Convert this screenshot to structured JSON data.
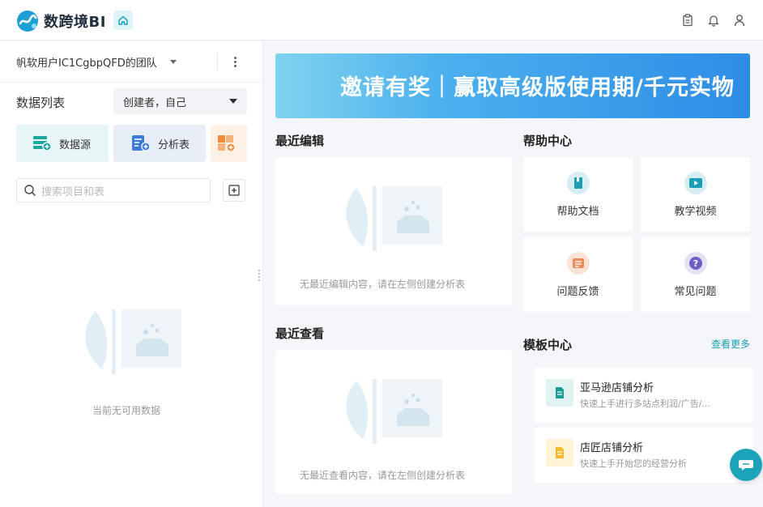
{
  "app": {
    "brand": "数跨境BI"
  },
  "team": {
    "name": "帆软用户IC1CgbpQFD的团队"
  },
  "sidebar": {
    "title": "数据列表",
    "creator_filter": "创建者，自己",
    "buttons": {
      "datasource": "数据源",
      "analysis": "分析表"
    },
    "search_placeholder": "搜索项目和表",
    "empty_text": "当前无可用数据"
  },
  "banner": {
    "text": "邀请有奖｜赢取高级版使用期/千元实物"
  },
  "recent_edit": {
    "title": "最近编辑",
    "empty_text": "无最近编辑内容，请在左侧创建分析表"
  },
  "recent_view": {
    "title": "最近查看",
    "empty_text": "无最近查看内容，请在左侧创建分析表"
  },
  "help": {
    "title": "帮助中心",
    "items": [
      {
        "label": "帮助文档"
      },
      {
        "label": "教学视频"
      },
      {
        "label": "问题反馈"
      },
      {
        "label": "常见问题"
      }
    ]
  },
  "templates": {
    "title": "模板中心",
    "see_more": "查看更多",
    "items": [
      {
        "name": "亚马逊店铺分析",
        "desc": "快速上手进行多站点利润/广告/..."
      },
      {
        "name": "店匠店铺分析",
        "desc": "快速上手开始您的经营分析"
      }
    ]
  },
  "colors": {
    "accent": "#1a9eb5",
    "banner_start": "#7fd3ef",
    "banner_end": "#2d8de6"
  }
}
